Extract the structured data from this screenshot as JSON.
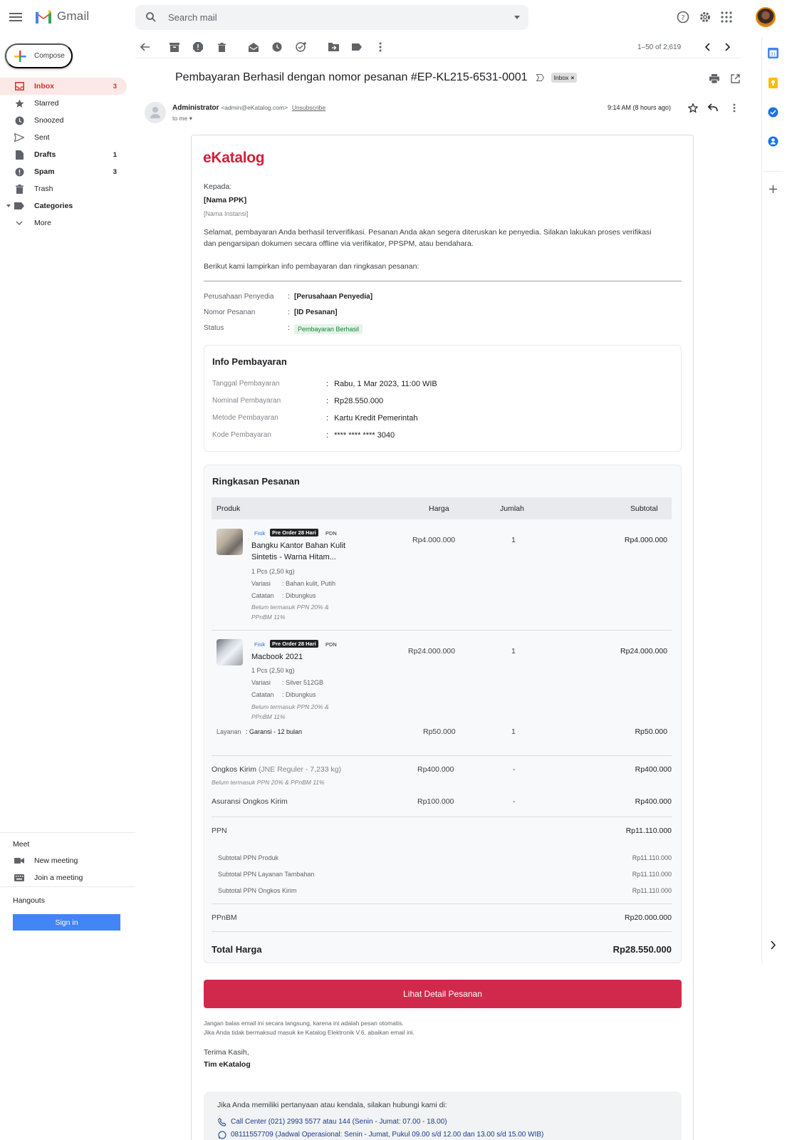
{
  "app": {
    "name": "Gmail"
  },
  "search": {
    "placeholder": "Search mail"
  },
  "compose": {
    "label": "Compose"
  },
  "nav": [
    {
      "label": "Inbox",
      "count": "3",
      "active": true
    },
    {
      "label": "Starred",
      "count": ""
    },
    {
      "label": "Snoozed",
      "count": ""
    },
    {
      "label": "Sent",
      "count": ""
    },
    {
      "label": "Drafts",
      "count": "1"
    },
    {
      "label": "Spam",
      "count": "3"
    },
    {
      "label": "Trash",
      "count": ""
    },
    {
      "label": "Categories",
      "count": ""
    },
    {
      "label": "More",
      "count": ""
    }
  ],
  "meet": {
    "title": "Meet",
    "new_meeting": "New meeting",
    "join_meeting": "Join a meeting"
  },
  "hangouts": {
    "title": "Hangouts",
    "sign_in": "Sign in"
  },
  "pager": {
    "text": "1–50 of 2,619"
  },
  "email": {
    "subject": "Pembayaran Berhasil dengan nomor pesanan #EP-KL215-6531-0001",
    "label": "Inbox",
    "sender_name": "Administrator",
    "sender_email": "<admin@eKatalog.com>",
    "unsubscribe": "Unsubscribe",
    "to": "to me",
    "time": "9:14 AM (8 hours ago)"
  },
  "body": {
    "brand": "eKatalog",
    "kepada": "Kepada:",
    "nama_ppk": "[Nama PPK]",
    "nama_instansi": "[Nama Instansi]",
    "para1_line1": "Selamat, pembayaran Anda berhasil terverifikasi. Pesanan Anda akan segera diteruskan ke penyedia. Silakan lakukan proses verifikasi",
    "para1_line2": "dan pengarsipan dokumen secara offline via verifikator, PPSPM, atau bendahara.",
    "para2": "Berikut kami lampirkan info pembayaran dan ringkasan pesanan:",
    "penyedia_label": "Perusahaan Penyedia",
    "penyedia_value": "[Perusahaan Penyedia]",
    "nomor_label": "Nomor Pesanan",
    "nomor_value": "[ID Pesanan]",
    "status_label": "Status",
    "status_value": "Pembayaran Berhasil",
    "colon": ":"
  },
  "info_pembayaran": {
    "title": "Info Pembayaran",
    "rows": [
      {
        "label": "Tanggal Pembayaran",
        "value": "Rabu, 1 Mar 2023, 11:00 WIB"
      },
      {
        "label": "Nominal Pembayaran",
        "value": "Rp28.550.000"
      },
      {
        "label": "Metode Pembayaran",
        "value": "Kartu Kredit Pemerintah"
      },
      {
        "label": "Kode Pembayaran",
        "value": "**** **** **** 3040"
      }
    ]
  },
  "ringkasan": {
    "title": "Ringkasan Pesanan",
    "headers": {
      "produk": "Produk",
      "harga": "Harga",
      "jumlah": "Jumlah",
      "subtotal": "Subtotal"
    },
    "products": [
      {
        "tag_fisik": "Fisik",
        "tag_po": "Pre Order 28 Hari",
        "tag_pdn": "PDN",
        "name_line1": "Bangku Kantor Bahan Kulit",
        "name_line2": "Sintetis - Warna Hitam...",
        "qty_detail": "1 Pcs (2,50 kg)",
        "variasi_label": "Variasi",
        "variasi_value": ": Bahan kulit, Putih",
        "catatan_label": "Catatan",
        "catatan_value": ": Dibungkus",
        "tax_note_line1": "Belum termasuk PPN 20% &",
        "tax_note_line2": "PPnBM 11%",
        "harga": "Rp4.000.000",
        "jumlah": "1",
        "subtotal": "Rp4.000.000"
      },
      {
        "tag_fisik": "Fisik",
        "tag_po": "Pre Order 28 Hari",
        "tag_pdn": "PDN",
        "name_line1": "Macbook 2021",
        "name_line2": "",
        "qty_detail": "1 Pcs (2,50 kg)",
        "variasi_label": "Variasi",
        "variasi_value": ": Silver 512GB",
        "catatan_label": "Catatan",
        "catatan_value": ": Dibungkus",
        "tax_note_line1": "Belum termasuk PPN 20% &",
        "tax_note_line2": "PPnBM 11%",
        "harga": "Rp24.000.000",
        "jumlah": "1",
        "subtotal": "Rp24.000.000"
      }
    ],
    "layanan": {
      "label": "Layanan",
      "value": ": Garansi - 12 bulan",
      "harga": "Rp50.000",
      "jumlah": "1",
      "subtotal": "Rp50.000"
    },
    "ongkir": {
      "label": "Ongkos Kirim",
      "detail": "(JNE Reguler - 7,233 kg)",
      "note": "Belum termasuk PPN 20% & PPnBM 11%",
      "harga": "Rp400.000",
      "jumlah": "-",
      "subtotal": "Rp400.000"
    },
    "asuransi": {
      "label": "Asuransi Ongkos Kirim",
      "harga": "Rp100.000",
      "jumlah": "-",
      "subtotal": "Rp400.000"
    },
    "ppn": {
      "label": "PPN",
      "value": "Rp11.110.000"
    },
    "ppn_rows": [
      {
        "label": "Subtotal PPN Produk",
        "value": "Rp11.110.000"
      },
      {
        "label": "Subtotal PPN Layanan Tambahan",
        "value": "Rp11.110.000"
      },
      {
        "label": "Subtotal PPN Ongkos Kirim",
        "value": "Rp11.110.000"
      }
    ],
    "ppnbm": {
      "label": "PPnBM",
      "value": "Rp20.000.000"
    },
    "total": {
      "label": "Total Harga",
      "value": "Rp28.550.000"
    }
  },
  "cta": {
    "label": "Lihat Detail Pesanan"
  },
  "footer": {
    "note1": "Jangan balas email ini secara langsung, karena ini adalah pesan otomatis.",
    "note2": "Jika Anda tidak bermaksud masuk ke Katalog Elektronik V.6, abaikan email ini.",
    "thanks": "Terima Kasih,",
    "team": "Tim eKatalog",
    "help": "Jika Anda memiliki pertanyaan atau kendala, silakan hubungi kami di:",
    "call": "Call Center (021) 2993 5577 atau 144 (Senin - Jumat: 07.00 - 18.00)",
    "wa": "08111557709 (Jadwal Operasional: Senin - Jumat, Pukul 09.00 s/d 12.00 dan  13.00 s/d 15.00 WIB)"
  },
  "colors": {
    "brand": "#d21f3c",
    "cta": "#d1294b",
    "inbox_active": "#d93025",
    "status_green": "#188038"
  }
}
